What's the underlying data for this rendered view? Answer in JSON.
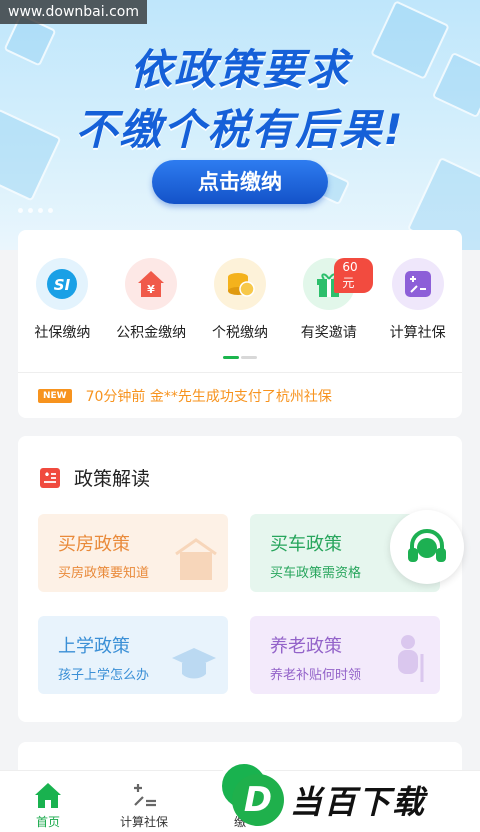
{
  "watermark": "www.downbai.com",
  "banner": {
    "headline1": "依政策要求",
    "headline2": "不缴个税有后果!",
    "button": "点击缴纳"
  },
  "services": [
    {
      "label": "社保缴纳",
      "icon": "social-security-icon",
      "color": "#1aa0e6"
    },
    {
      "label": "公积金缴纳",
      "icon": "house-fund-icon",
      "color": "#f05a4a"
    },
    {
      "label": "个税缴纳",
      "icon": "coins-icon",
      "color": "#f4b21c"
    },
    {
      "label": "有奖邀请",
      "icon": "gift-icon",
      "color": "#2dbf6c",
      "badge": "60元"
    },
    {
      "label": "计算社保",
      "icon": "calculator-icon",
      "color": "#8d5fd8"
    }
  ],
  "news": {
    "tag": "NEW",
    "text": "70分钟前 金**先生成功支付了杭州社保"
  },
  "policy": {
    "title": "政策解读",
    "items": [
      {
        "title": "买房政策",
        "subtitle": "买房政策要知道"
      },
      {
        "title": "买车政策",
        "subtitle": "买车政策需资格"
      },
      {
        "title": "上学政策",
        "subtitle": "孩子上学怎么办"
      },
      {
        "title": "养老政策",
        "subtitle": "养老补贴何时领"
      }
    ]
  },
  "tabbar": {
    "tabs": [
      {
        "label": "首页",
        "icon": "home-icon",
        "active": true
      },
      {
        "label": "计算社保",
        "icon": "calculator-icon"
      },
      {
        "label": "缴"
      }
    ]
  },
  "site_logo": {
    "letter": "D",
    "text": "当百下载"
  },
  "colors": {
    "accent": "#19b24f",
    "banner_blue": "#1560d8",
    "news_orange": "#f7931e"
  }
}
